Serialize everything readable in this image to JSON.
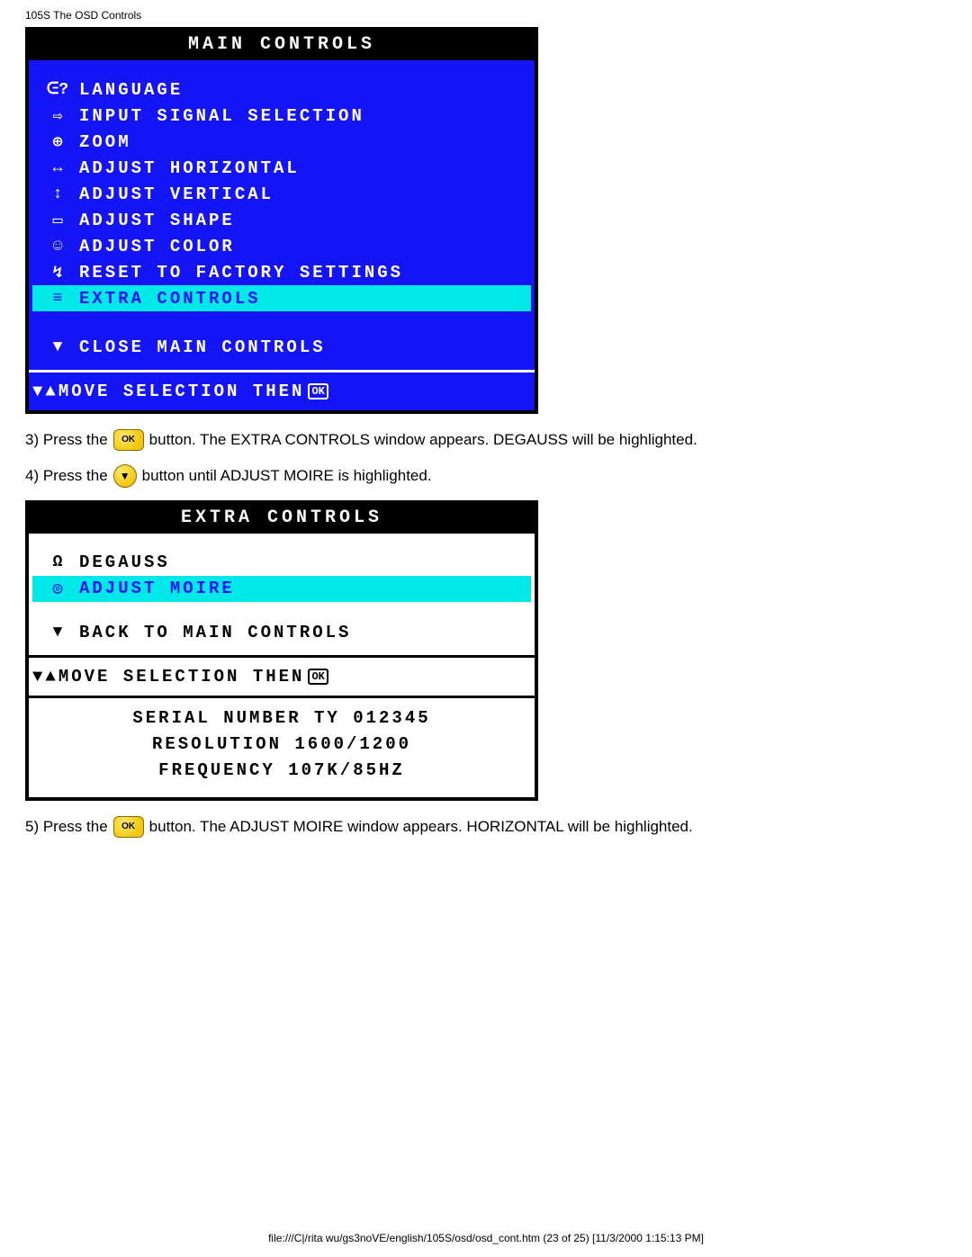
{
  "header": "105S The OSD Controls",
  "main_osd": {
    "title": "MAIN CONTROLS",
    "items": [
      {
        "icon": "ᕮ?",
        "label": "LANGUAGE"
      },
      {
        "icon": "⇨",
        "label": "INPUT SIGNAL SELECTION"
      },
      {
        "icon": "⊕",
        "label": "ZOOM"
      },
      {
        "icon": "↔",
        "label": "ADJUST HORIZONTAL"
      },
      {
        "icon": "↕",
        "label": "ADJUST VERTICAL"
      },
      {
        "icon": "▭",
        "label": "ADJUST SHAPE"
      },
      {
        "icon": "☺",
        "label": "ADJUST COLOR"
      },
      {
        "icon": "↯",
        "label": "RESET TO FACTORY SETTINGS"
      },
      {
        "icon": "≡",
        "label": "EXTRA CONTROLS"
      }
    ],
    "close": {
      "icon": "▼",
      "label": "CLOSE MAIN CONTROLS"
    },
    "hint": {
      "icon": "▼▲",
      "label": "MOVE SELECTION THEN",
      "ok": "OK"
    }
  },
  "step3": {
    "pre": "3) Press the",
    "post": "button. The EXTRA CONTROLS window appears. DEGAUSS will be highlighted.",
    "btn": "OK"
  },
  "step4": {
    "pre": "4) Press the",
    "post": "button until ADJUST MOIRE is highlighted.",
    "btn": "▼"
  },
  "extra_osd": {
    "title": "EXTRA CONTROLS",
    "items": [
      {
        "icon": "Ω",
        "label": "DEGAUSS"
      },
      {
        "icon": "◎",
        "label": "ADJUST MOIRE"
      }
    ],
    "back": {
      "icon": "▼",
      "label": "BACK TO MAIN CONTROLS"
    },
    "hint": {
      "icon": "▼▲",
      "label": "MOVE SELECTION THEN",
      "ok": "OK"
    },
    "serial": "SERIAL NUMBER TY 012345",
    "resolution": "RESOLUTION 1600/1200",
    "frequency": "FREQUENCY 107K/85HZ"
  },
  "step5": {
    "pre": "5) Press the",
    "post": "button. The ADJUST MOIRE window appears. HORIZONTAL will be highlighted.",
    "btn": "OK"
  },
  "footer": "file:///C|/rita wu/gs3noVE/english/105S/osd/osd_cont.htm (23 of 25) [11/3/2000 1:15:13 PM]"
}
